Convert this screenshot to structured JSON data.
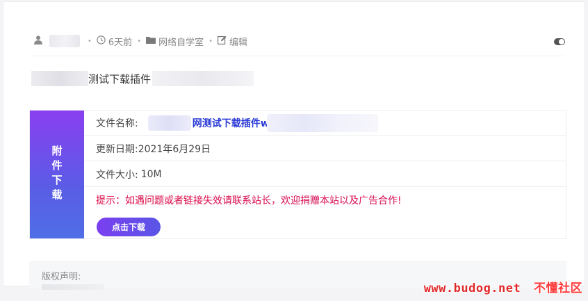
{
  "meta": {
    "user_icon": "user-icon",
    "time_icon": "clock-icon",
    "time": "6天前",
    "folder_icon": "folder-icon",
    "category": "网络自学室",
    "edit_icon": "edit-icon",
    "edit_label": "编辑",
    "separator": "•"
  },
  "post": {
    "title_visible": "测试下载插件"
  },
  "download": {
    "side_label": "附件下载",
    "file_name_label": "文件名称:",
    "file_name": "网测试下载插件w",
    "update_label": "更新日期:",
    "update_date": "2021年6月29日",
    "size_label": "文件大小:",
    "size": "10M",
    "tip": "提示：如遇问题或者链接失效请联系站长，欢迎捐赠本站以及广告合作!",
    "button_label": "点击下载",
    "accent_start": "#8a3ff0",
    "accent_end": "#4f6fe6"
  },
  "copyright": {
    "label": "版权声明:"
  },
  "watermark": {
    "url": "www.budog.net",
    "site": "不懂社区"
  }
}
